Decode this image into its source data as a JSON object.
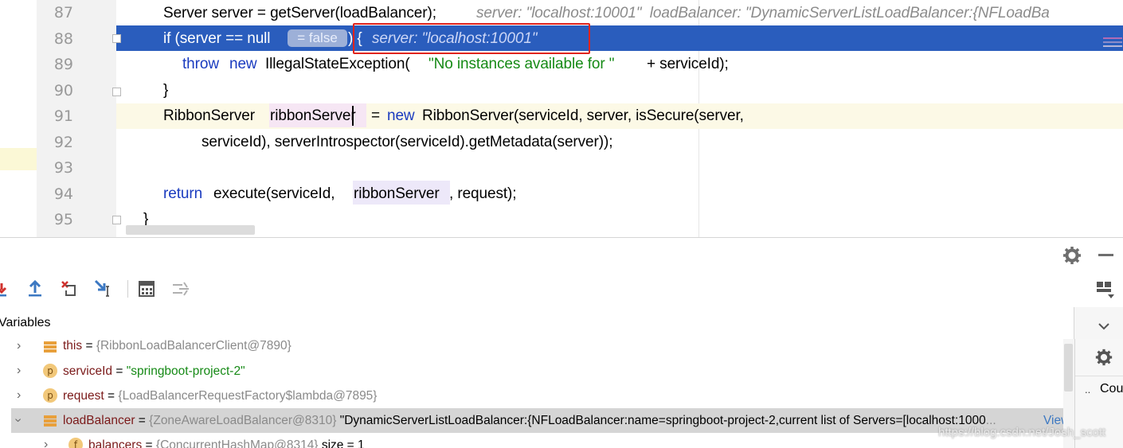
{
  "editor": {
    "line_numbers": [
      "87",
      "88",
      "89",
      "90",
      "91",
      "92",
      "93",
      "94",
      "95"
    ],
    "lines": {
      "l87_a": "Server server = getServer(loadBalancer);",
      "l87_hint": "server: \"localhost:10001\"  loadBalancer: \"DynamicServerListLoadBalancer:{NFLoadBa",
      "l88_a": "if (server == null",
      "l88_badge": "= false",
      "l88_b": ") {",
      "l88_hint": "server: \"localhost:10001\"",
      "l89_kw1": "throw",
      "l89_kw2": "new",
      "l89_a": "IllegalStateException(",
      "l89_str": "\"No instances available for \"",
      "l89_b": "+ serviceId);",
      "l90": "}",
      "l91_a": "RibbonServer",
      "l91_b": "ribbonServer",
      "l91_c": "=",
      "l91_kw": "new",
      "l91_d": "RibbonServer(serviceId, server, isSecure(server,",
      "l92": "serviceId), serverIntrospector(serviceId).getMetadata(server));",
      "l94_kw": "return",
      "l94_a": "execute(serviceId,",
      "l94_b": "ribbonServer",
      "l94_c": ", request);",
      "l95": "}"
    }
  },
  "panel": {
    "variables_title": "Variables",
    "right_label": "Cou",
    "right_dots": "..",
    "rows": [
      {
        "name": "this",
        "eq": "=",
        "value": "{RibbonLoadBalancerClient@7890}"
      },
      {
        "name": "serviceId",
        "eq": "=",
        "value": "\"springboot-project-2\""
      },
      {
        "name": "request",
        "eq": "=",
        "value": "{LoadBalancerRequestFactory$lambda@7895}"
      },
      {
        "name": "loadBalancer",
        "eq": "=",
        "value": "{ZoneAwareLoadBalancer@8310}",
        "text": "\"DynamicServerListLoadBalancer:{NFLoadBalancer:name=springboot-project-2,current list of Servers=[localhost:1000",
        "ellipsis": "...",
        "link": "View"
      },
      {
        "name": "balancers",
        "eq": "=",
        "value": "{ConcurrentHashMap@8314}",
        "extra": "size = 1"
      }
    ],
    "icons": {
      "gear": "gear-icon",
      "minimize": "minimize-icon",
      "layout": "layout-icon",
      "collapse": "chevron-down-icon"
    }
  },
  "watermark": "https://blog.csdn.net/Josh_scott"
}
